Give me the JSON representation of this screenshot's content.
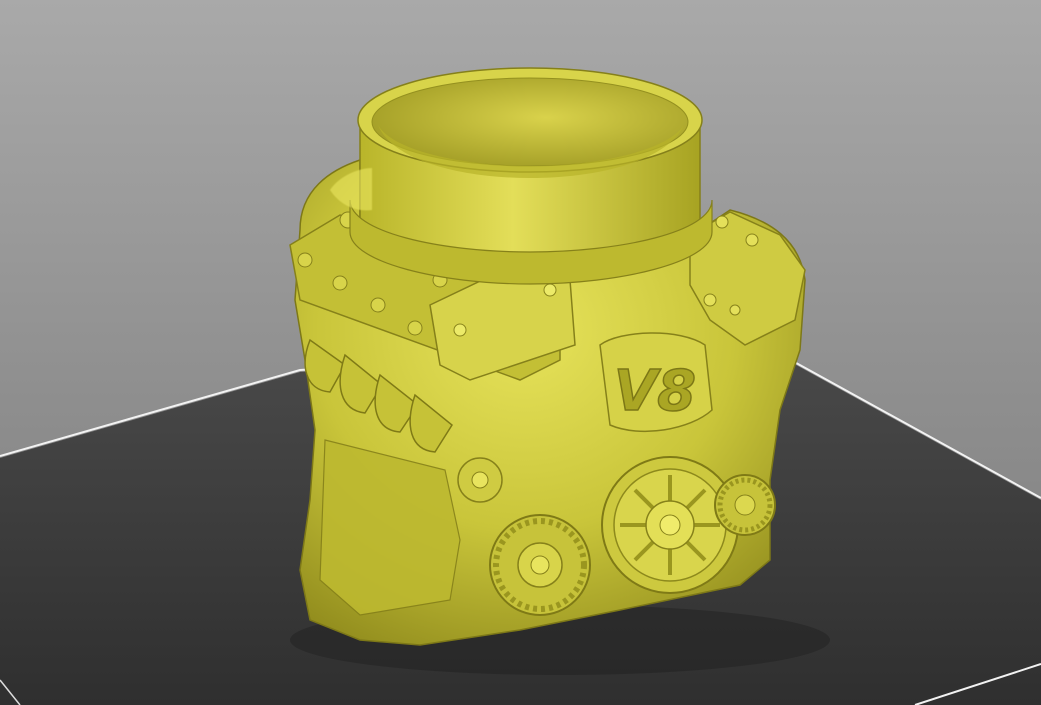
{
  "viewport": {
    "background_color": "#9a9a9a",
    "build_plate_color": "#3f3f3f",
    "plate_edge_color": "#f2f2f2",
    "model_color": "#c9c53a",
    "model_shadow_color": "#8f8a1c",
    "model_highlight_color": "#e6e25a"
  },
  "model": {
    "engraving_text": "V8"
  }
}
